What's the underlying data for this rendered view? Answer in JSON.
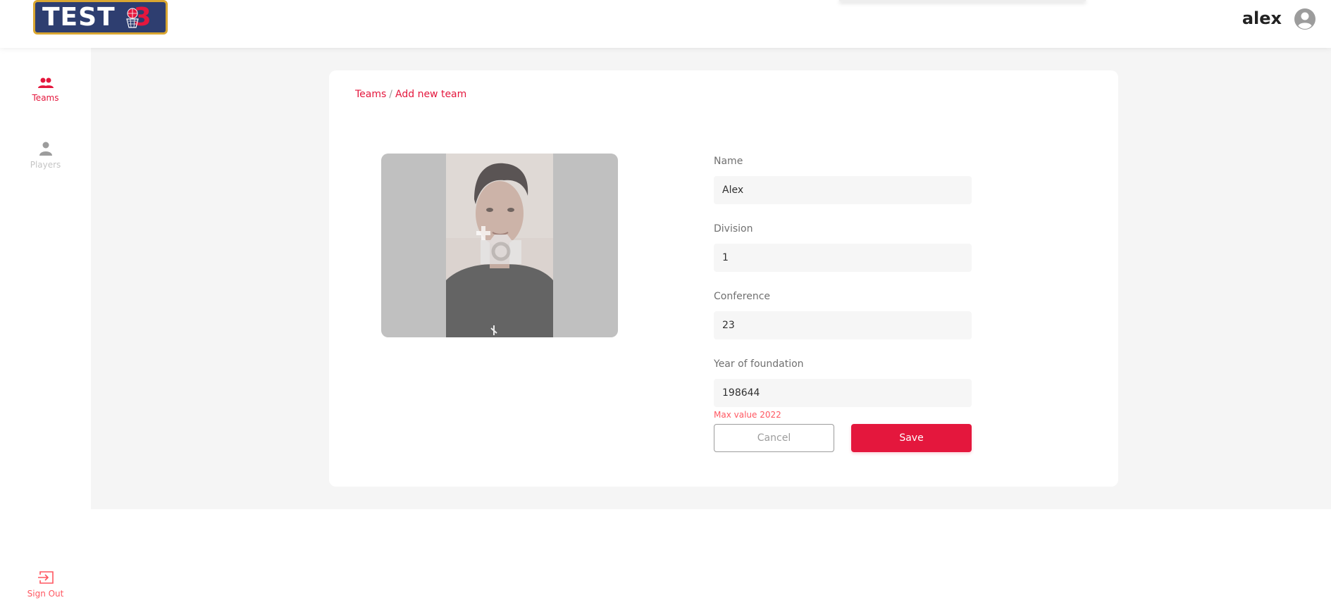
{
  "header": {
    "logo_text": "TEST",
    "logo_number": "3",
    "user_name": "alex"
  },
  "sidebar": {
    "items": [
      {
        "label": "Teams",
        "icon": "teams-icon",
        "active": true
      },
      {
        "label": "Players",
        "icon": "person-icon",
        "active": false
      }
    ],
    "signout_label": "Sign Out"
  },
  "breadcrumb": {
    "root": "Teams",
    "separator": "/",
    "current": "Add new team"
  },
  "form": {
    "image": {
      "icon": "add-photo-icon"
    },
    "fields": [
      {
        "label": "Name",
        "value": "Alex"
      },
      {
        "label": "Division",
        "value": "1"
      },
      {
        "label": "Conference",
        "value": "23"
      },
      {
        "label": "Year of foundation",
        "value": "198644"
      }
    ],
    "error": "Max value 2022",
    "cancel_label": "Cancel",
    "save_label": "Save"
  },
  "colors": {
    "accent": "#e4173d",
    "error": "#ff5761",
    "muted": "#9c9c9c",
    "background": "#f5f5f5"
  }
}
